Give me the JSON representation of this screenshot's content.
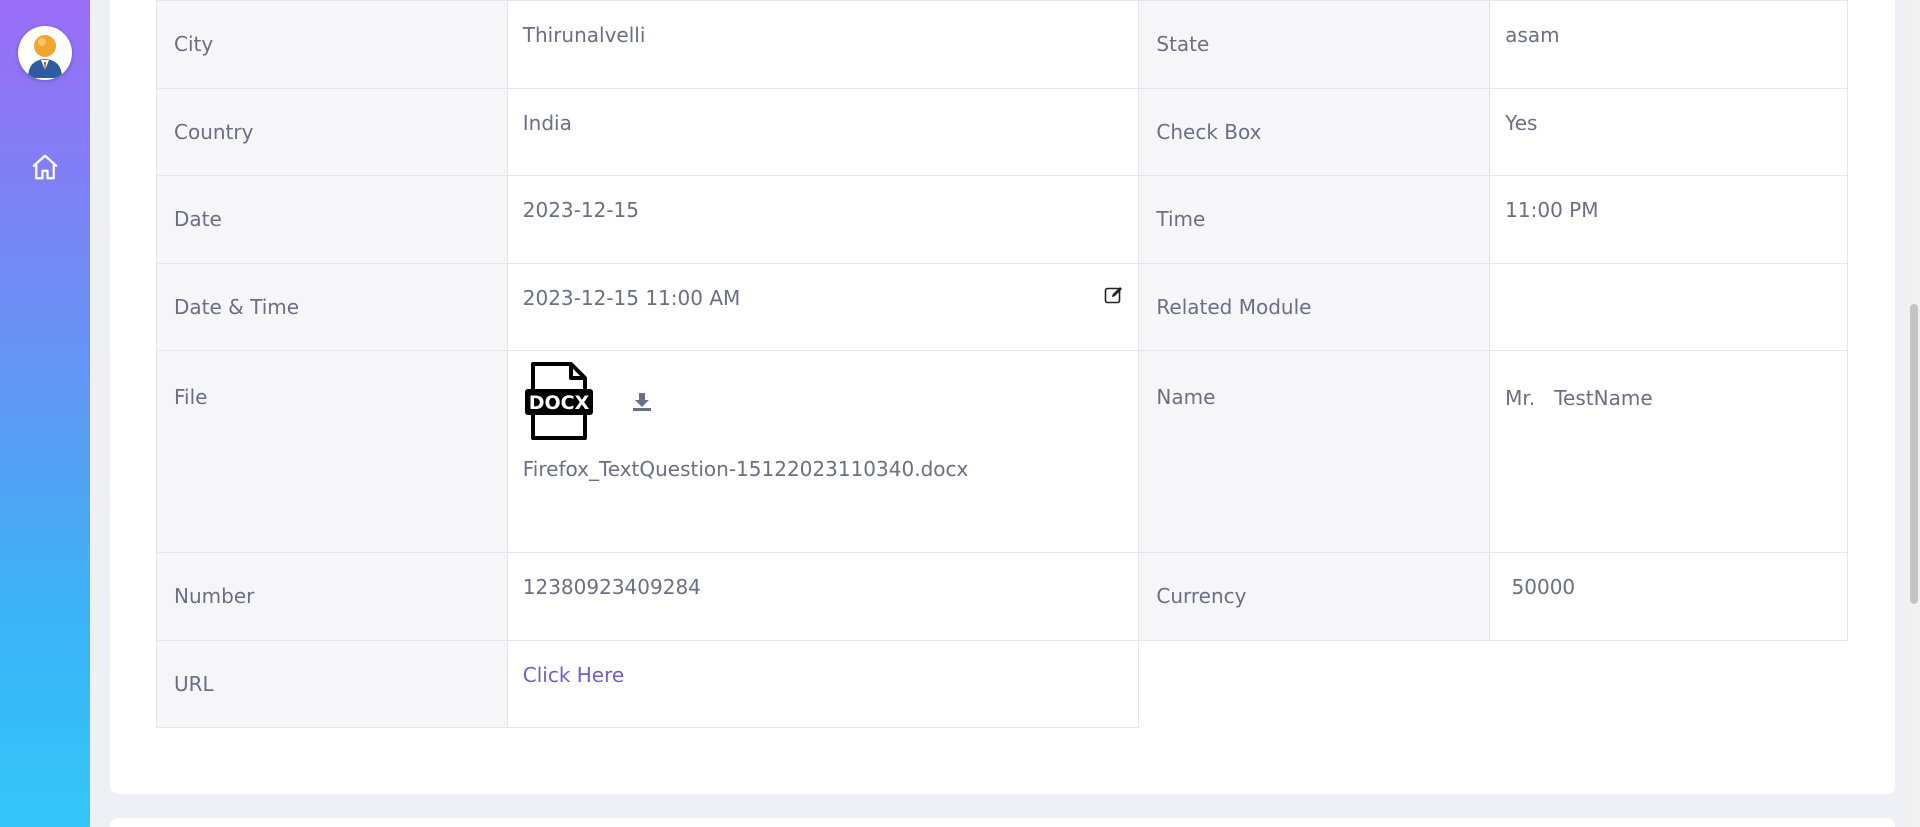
{
  "details": {
    "rows": [
      {
        "l1": "City",
        "v1": "Thirunalvelli",
        "l2": "State",
        "v2": "asam"
      },
      {
        "l1": "Country",
        "v1": "India",
        "l2": "Check Box",
        "v2": "Yes"
      },
      {
        "l1": "Date",
        "v1": "2023-12-15",
        "l2": "Time",
        "v2": "11:00 PM"
      },
      {
        "l1": "Date & Time",
        "v1": "2023-12-15 11:00 AM",
        "l2": "Related Module",
        "v2": ""
      },
      {
        "l1": "File",
        "v1": "Firefox_TextQuestion-15122023110340.docx",
        "l2": "Name",
        "v2": "Mr.   TestName"
      },
      {
        "l1": "Number",
        "v1": "12380923409284",
        "l2": "Currency",
        "v2": " 50000"
      },
      {
        "l1": "URL",
        "v1": "Click Here"
      }
    ],
    "file_badge": "DOCX"
  },
  "icons": {
    "avatar": "user-avatar",
    "home": "home-icon",
    "edit": "edit-icon",
    "file": "docx-file-icon",
    "download": "download-icon"
  },
  "colors": {
    "sidebar_top": "#9a6df7",
    "sidebar_bottom": "#33c6f9",
    "link": "#6a63c6",
    "label_bg": "#f6f6f9",
    "page_bg": "#eff0f6"
  }
}
